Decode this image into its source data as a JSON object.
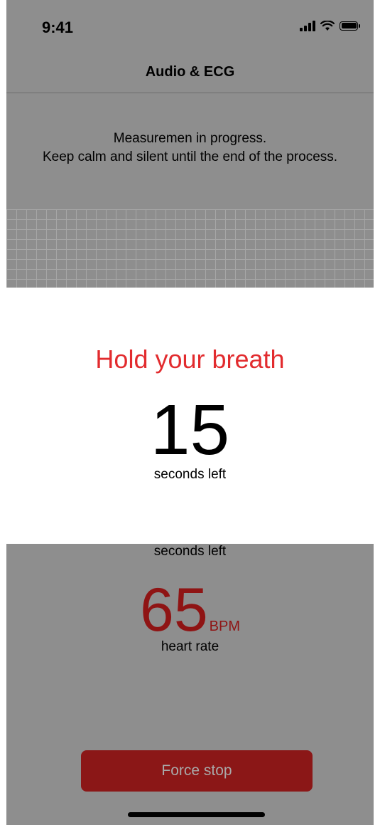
{
  "status_bar": {
    "time": "9:41",
    "icons": [
      "signal-icon",
      "wifi-icon",
      "battery-icon"
    ]
  },
  "navbar": {
    "title": "Audio & ECG"
  },
  "instructions": {
    "line1": "Measuremen in progress.",
    "line2": "Keep calm and silent until the end of the process."
  },
  "background_timer": {
    "label": "seconds left"
  },
  "heart_rate": {
    "value": "65",
    "unit": "BPM",
    "label": "heart rate"
  },
  "actions": {
    "force_stop_label": "Force stop"
  },
  "modal": {
    "title": "Hold your breath",
    "countdown": "15",
    "caption": "seconds left"
  },
  "colors": {
    "accent_red": "#e22b2e",
    "dark_red": "#8f1414",
    "overlay_gray": "#8e8e8e"
  }
}
